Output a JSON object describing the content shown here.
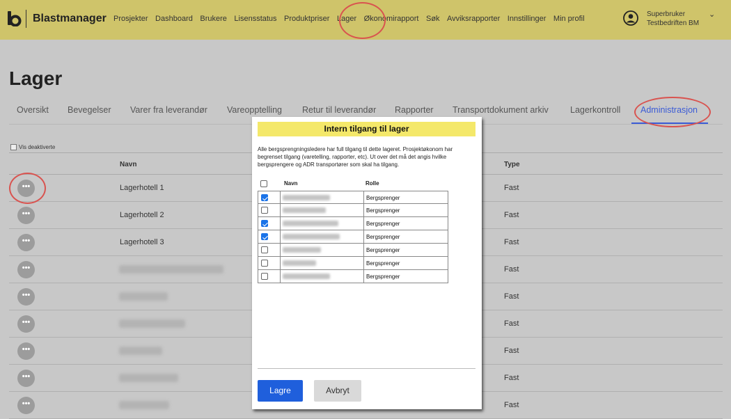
{
  "brand": "Blastmanager",
  "nav": [
    "Prosjekter",
    "Dashboard",
    "Brukere",
    "Lisensstatus",
    "Produktpriser",
    "Lager",
    "Økonomirapport",
    "Søk",
    "Avviksrapporter",
    "Innstillinger",
    "Min profil"
  ],
  "user": {
    "role": "Superbruker",
    "company": "Testbedriften BM"
  },
  "page_title": "Lager",
  "tabs": [
    "Oversikt",
    "Bevegelser",
    "Varer fra leverandør",
    "Vareopptelling",
    "Retur til leverandør",
    "Rapporter",
    "Transportdokument arkiv",
    "Lagerkontroll",
    "Administrasjon"
  ],
  "active_tab": "Administrasjon",
  "show_deactivated": "Vis deaktiverte",
  "table": {
    "headers": {
      "name": "Navn",
      "type": "Type"
    },
    "rows": [
      {
        "name": "Lagerhotell 1",
        "type": "Fast"
      },
      {
        "name": "Lagerhotell 2",
        "type": "Fast"
      },
      {
        "name": "Lagerhotell 3",
        "type": "Fast"
      },
      {
        "name": "",
        "type": "Fast"
      },
      {
        "name": "",
        "type": "Fast"
      },
      {
        "name": "",
        "type": "Fast"
      },
      {
        "name": "",
        "type": "Fast"
      },
      {
        "name": "",
        "type": "Fast"
      },
      {
        "name": "",
        "type": "Fast"
      }
    ],
    "actions_glyph": "•••"
  },
  "modal": {
    "title": "Intern tilgang til lager",
    "description": "Alle bergsprengningsledere har full tilgang til dette lageret. Prosjektøkonom har begrenset tilgang (varetelling, rapporter, etc). Ut over det må det angis hvilke bergsprengere og ADR transportører som skal ha tilgang.",
    "headers": {
      "name": "Navn",
      "role": "Rolle"
    },
    "rows": [
      {
        "checked": true,
        "role": "Bergsprenger"
      },
      {
        "checked": false,
        "role": "Bergsprenger"
      },
      {
        "checked": true,
        "role": "Bergsprenger"
      },
      {
        "checked": true,
        "role": "Bergsprenger"
      },
      {
        "checked": false,
        "role": "Bergsprenger"
      },
      {
        "checked": false,
        "role": "Bergsprenger"
      },
      {
        "checked": false,
        "role": "Bergsprenger"
      }
    ],
    "save": "Lagre",
    "cancel": "Avbryt"
  },
  "colors": {
    "topbar": "#cfc46a",
    "accent": "#1f5fdc",
    "annotation": "#d9534f",
    "modal_header": "#f4e86a"
  }
}
